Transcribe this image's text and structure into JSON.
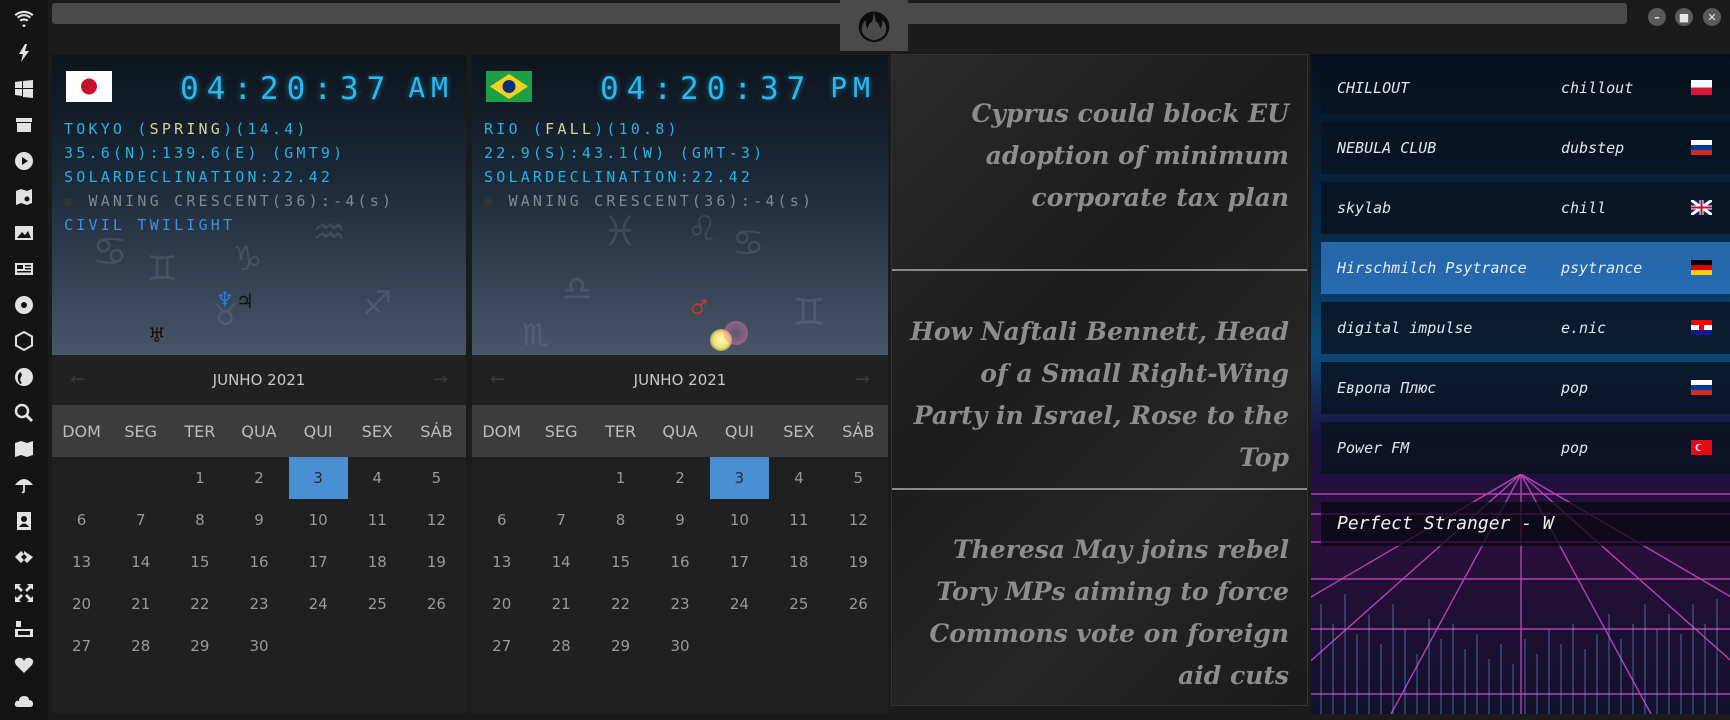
{
  "sidebar": {
    "items": [
      "wifi-icon",
      "lightning-icon",
      "windows-icon",
      "archive-icon",
      "play-icon",
      "atlas-icon",
      "image-icon",
      "news-icon",
      "settings-wheel-icon",
      "hexagon-icon",
      "globe-icon",
      "search-icon",
      "map-icon",
      "umbrella-icon",
      "contacts-icon",
      "tags-icon",
      "expand-icon",
      "youtube-icon",
      "heart-icon",
      "cloud-icon"
    ]
  },
  "window": {
    "minimize": "–",
    "maximize": "■",
    "close": "✕",
    "logo": "rebel-alliance-icon"
  },
  "clocks": [
    {
      "flag": "japan-flag",
      "time": "04:20:37",
      "ampm": "AM",
      "city": "TOKYO",
      "season": "SPRING",
      "daylight": "(14.4)",
      "coords": "35.6(N):139.6(E) (GMT9)",
      "solar": "SOLARDECLINATION:22.42",
      "moon": "WANING CRESCENT(36):-4(s)",
      "twilight": "CIVIL TWILIGHT",
      "month": "JUNHO 2021"
    },
    {
      "flag": "brazil-flag",
      "time": "04:20:37",
      "ampm": "PM",
      "city": "RIO",
      "season": "FALL",
      "daylight": "(10.8)",
      "coords": "22.9(S):43.1(W) (GMT-3)",
      "solar": "SOLARDECLINATION:22.42",
      "moon": "WANING CRESCENT(36):-4(s)",
      "twilight": "",
      "month": "JUNHO 2021"
    }
  ],
  "calendar": {
    "weekdays": [
      "DOM",
      "SEG",
      "TER",
      "QUA",
      "QUI",
      "SEX",
      "SÁB"
    ],
    "leading_blanks": 2,
    "days": 30,
    "today": 3
  },
  "news": [
    "Cyprus could block EU adoption of minimum corporate tax plan",
    "How Naftali Bennett, Head of a Small Right-Wing Party in Israel, Rose to the Top",
    "Theresa May joins rebel Tory MPs aiming to force Commons vote on foreign aid cuts"
  ],
  "radio": {
    "stations": [
      {
        "name": "CHILLOUT",
        "genre": "chillout",
        "flag": "poland-flag",
        "active": false
      },
      {
        "name": "NEBULA CLUB",
        "genre": "dubstep",
        "flag": "russia-flag",
        "active": false
      },
      {
        "name": "skylab",
        "genre": "chill",
        "flag": "uk-flag",
        "active": false
      },
      {
        "name": "Hirschmilch Psytrance",
        "genre": "psytrance",
        "flag": "germany-flag",
        "active": true
      },
      {
        "name": "digital impulse",
        "genre": "e.nic",
        "flag": "croatia-flag",
        "active": false
      },
      {
        "name": "Европа Плюс",
        "genre": "pop",
        "flag": "russia-flag",
        "active": false
      },
      {
        "name": "Power FM",
        "genre": "pop",
        "flag": "turkey-flag",
        "active": false
      }
    ],
    "now_playing": "Perfect Stranger - W"
  },
  "colors": {
    "clock": "#2ab8ee",
    "today": "#4a8fd4",
    "twilight": "#3d8ee6"
  }
}
